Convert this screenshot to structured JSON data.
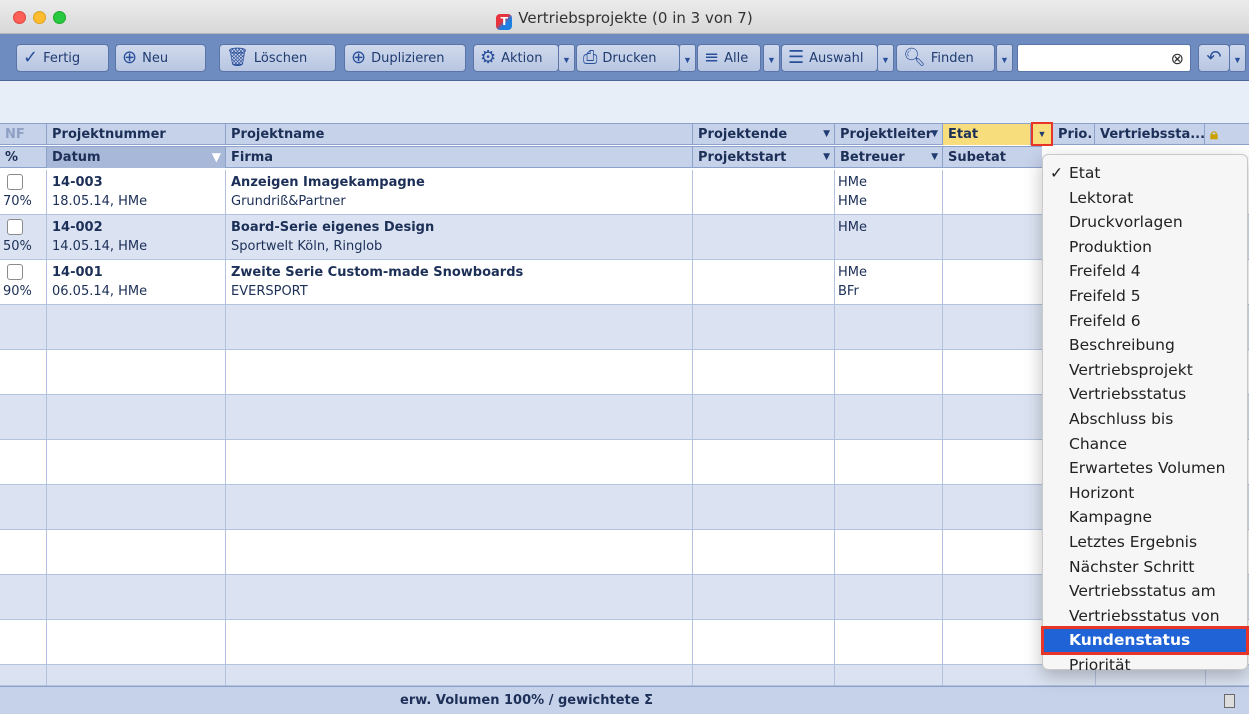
{
  "window": {
    "title": "Vertriebsprojekte (0 in 3 von 7)",
    "app_icon_letter": "T"
  },
  "toolbar": {
    "fertig": "Fertig",
    "neu": "Neu",
    "loeschen": "Löschen",
    "duplizieren": "Duplizieren",
    "aktion": "Aktion",
    "drucken": "Drucken",
    "alle": "Alle",
    "auswahl": "Auswahl",
    "finden": "Finden",
    "search_value": ""
  },
  "header": {
    "nf": "NF",
    "projektnummer": "Projektnummer",
    "projektname": "Projektname",
    "projektende": "Projektende",
    "projektleiter": "Projektleiter",
    "etat": "Etat",
    "prio": "Prio.",
    "vertriebsstatus": "Vertriebssta...",
    "pct": "%",
    "datum": "Datum",
    "firma": "Firma",
    "projektstart": "Projektstart",
    "betreuer": "Betreuer",
    "subetat": "Subetat"
  },
  "rows": [
    {
      "nummer": "14-003",
      "pct": "70%",
      "datum": "18.05.14, HMe",
      "name": "Anzeigen Imagekampagne",
      "firma": "Grundriß&Partner",
      "leiter": "HMe",
      "betreuer": "HMe"
    },
    {
      "nummer": "14-002",
      "pct": "50%",
      "datum": "14.05.14, HMe",
      "name": "Board-Serie eigenes Design",
      "firma": "Sportwelt Köln, Ringlob",
      "leiter": "HMe",
      "betreuer": ""
    },
    {
      "nummer": "14-001",
      "pct": "90%",
      "datum": "06.05.14, HMe",
      "name": "Zweite Serie Custom-made Snowboards",
      "firma": "EVERSPORT",
      "leiter": "HMe",
      "betreuer": "BFr"
    }
  ],
  "footer": {
    "label": "erw. Volumen 100% / gewichtete Σ"
  },
  "menu": {
    "items": [
      "Etat",
      "Lektorat",
      "Druckvorlagen",
      "Produktion",
      "Freifeld 4",
      "Freifeld 5",
      "Freifeld 6",
      "Beschreibung",
      "Vertriebsprojekt",
      "Vertriebsstatus",
      "Abschluss bis",
      "Chance",
      "Erwartetes Volumen",
      "Horizont",
      "Kampagne",
      "Letztes Ergebnis",
      "Nächster Schritt",
      "Vertriebsstatus am",
      "Vertriebsstatus von",
      "Kundenstatus",
      "Priorität"
    ],
    "checked": "Etat",
    "highlighted": "Kundenstatus"
  },
  "colors": {
    "toolbar": "#6f8cc0",
    "header": "#c6d2ea",
    "etat_header": "#f7dd7c",
    "highlight": "#1f63d6",
    "annotation_red": "#e8352a"
  }
}
